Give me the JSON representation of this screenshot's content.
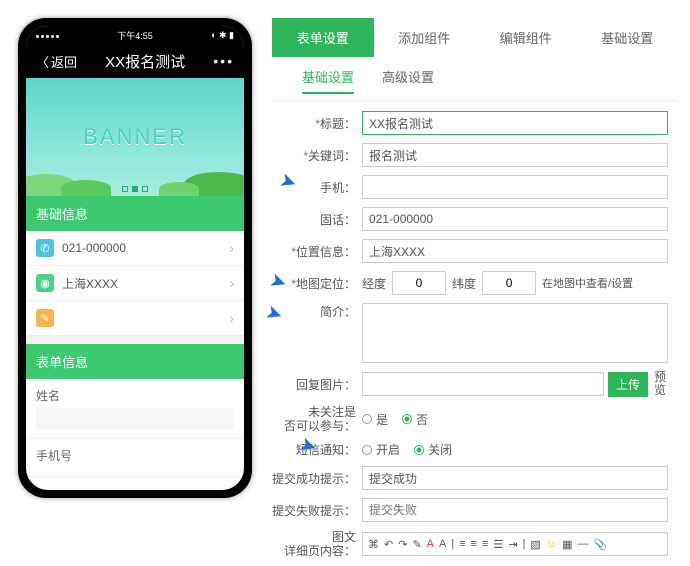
{
  "phone": {
    "status_time": "下午4:55",
    "back": "返回",
    "title": "XX报名测试",
    "banner": "BANNER",
    "section1": "基础信息",
    "row_phone": "021-000000",
    "row_location": "上海XXXX",
    "section2": "表单信息",
    "field_name": "姓名",
    "field_mobile": "手机号"
  },
  "tabs": {
    "main": [
      "表单设置",
      "添加组件",
      "编辑组件",
      "基础设置"
    ],
    "sub": [
      "基础设置",
      "高级设置"
    ]
  },
  "form": {
    "title_label": "标题：",
    "title_value": "XX报名测试",
    "keyword_label": "关键词：",
    "keyword_value": "报名测试",
    "mobile_label": "手机：",
    "tel_label": "固话：",
    "tel_value": "021-000000",
    "location_label": "位置信息：",
    "location_value": "上海XXXX",
    "map_label": "地图定位：",
    "lng_label": "经度",
    "lng_value": "0",
    "lat_label": "纬度",
    "lat_value": "0",
    "map_link": "在地图中查看/设置",
    "intro_label": "简介：",
    "reply_img_label": "回复图片：",
    "upload_btn": "上传",
    "preview": "预览",
    "follow_label1": "未关注是",
    "follow_label2": "否可以参与：",
    "radio_yes": "是",
    "radio_no": "否",
    "sms_label": "短信通知：",
    "sms_on": "开启",
    "sms_off": "关闭",
    "success_label": "提交成功提示：",
    "success_value": "提交成功",
    "fail_label": "提交失败提示：",
    "fail_placeholder": "提交失败",
    "detail_label1": "图文",
    "detail_label2": "详细页内容："
  }
}
